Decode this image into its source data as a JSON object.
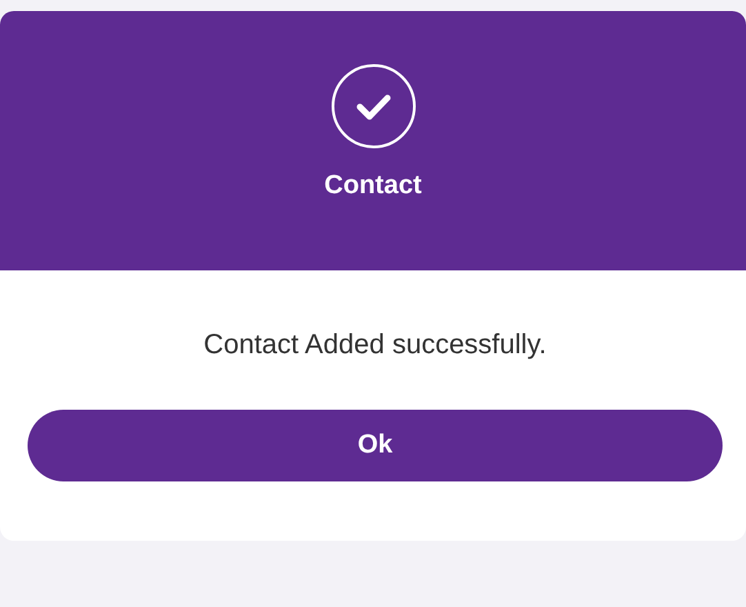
{
  "dialog": {
    "title": "Contact",
    "message": "Contact Added successfully.",
    "buttons": [
      {
        "label": "Ok"
      }
    ]
  }
}
